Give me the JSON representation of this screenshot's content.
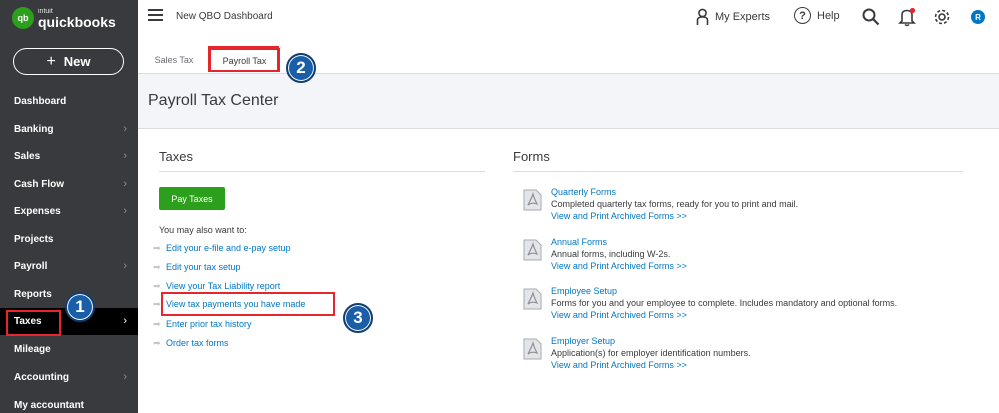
{
  "app": {
    "brand_small": "intuit",
    "brand_name": "quickbooks",
    "logo_mark": "qb",
    "dashboard_title": "New QBO Dashboard"
  },
  "sidebar": {
    "new_label": "New",
    "items": [
      {
        "label": "Dashboard",
        "chevron": false
      },
      {
        "label": "Banking",
        "chevron": true
      },
      {
        "label": "Sales",
        "chevron": true
      },
      {
        "label": "Cash Flow",
        "chevron": true
      },
      {
        "label": "Expenses",
        "chevron": true
      },
      {
        "label": "Projects",
        "chevron": false
      },
      {
        "label": "Payroll",
        "chevron": true
      },
      {
        "label": "Reports",
        "chevron": false
      },
      {
        "label": "Taxes",
        "chevron": true,
        "active": true
      },
      {
        "label": "Mileage",
        "chevron": false
      },
      {
        "label": "Accounting",
        "chevron": true
      },
      {
        "label": "My accountant",
        "chevron": false
      }
    ]
  },
  "topbar": {
    "experts_label": "My Experts",
    "help_label": "Help",
    "avatar_initial": "R"
  },
  "tabs": [
    {
      "label": "Sales Tax"
    },
    {
      "label": "Payroll Tax",
      "active": true
    }
  ],
  "page": {
    "title": "Payroll Tax Center"
  },
  "taxes": {
    "heading": "Taxes",
    "pay_button": "Pay Taxes",
    "may_also": "You may also want to:",
    "links": [
      "Edit your e-file and e-pay setup",
      "Edit your tax setup",
      "View your Tax Liability report",
      "View tax payments you have made",
      "Enter prior tax history",
      "Order tax forms"
    ]
  },
  "forms": {
    "heading": "Forms",
    "items": [
      {
        "title": "Quarterly Forms",
        "desc": "Completed quarterly tax forms, ready for you to print and mail.",
        "link": "View and Print Archived Forms >>"
      },
      {
        "title": "Annual Forms",
        "desc": "Annual forms, including W-2s.",
        "link": "View and Print Archived Forms >>"
      },
      {
        "title": "Employee Setup",
        "desc": "Forms for you and your employee to complete. Includes mandatory and optional forms.",
        "link": "View and Print Archived Forms >>"
      },
      {
        "title": "Employer Setup",
        "desc": "Application(s) for employer identification numbers.",
        "link": "View and Print Archived Forms >>"
      }
    ]
  },
  "annotations": {
    "badge_1": "1",
    "badge_2": "2",
    "badge_3": "3"
  },
  "colors": {
    "sidebar_bg": "#393a3d",
    "accent_green": "#2ca01c",
    "link_blue": "#0077c5",
    "highlight_red": "#e5262c",
    "badge_blue": "#1a5ea8"
  }
}
